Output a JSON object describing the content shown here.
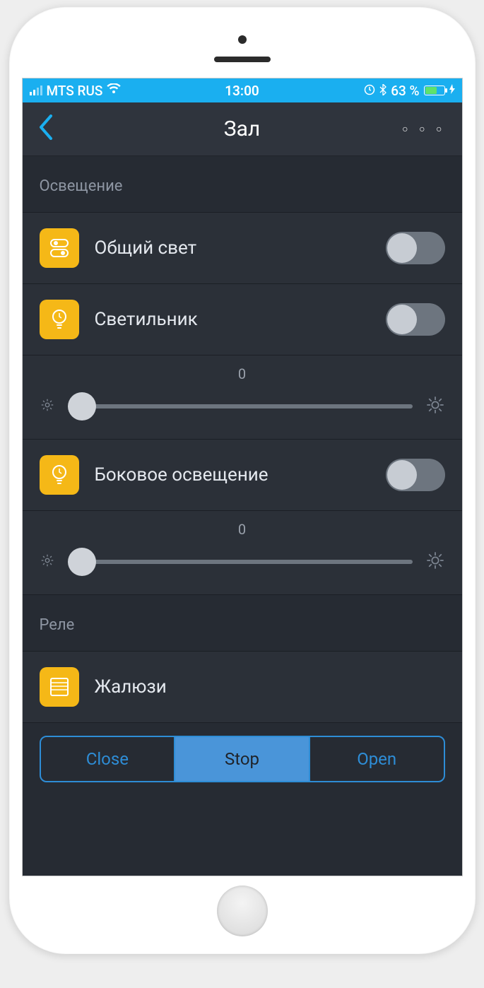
{
  "status": {
    "carrier": "MTS RUS",
    "time": "13:00",
    "battery_text": "63 %",
    "battery_pct": 63
  },
  "nav": {
    "title": "Зал"
  },
  "sections": {
    "lighting": {
      "header": "Освещение",
      "items": [
        {
          "label": "Общий свет",
          "toggle": false
        },
        {
          "label": "Светильник",
          "toggle": false,
          "slider_value": "0"
        },
        {
          "label": "Боковое освещение",
          "toggle": false,
          "slider_value": "0"
        }
      ]
    },
    "relay": {
      "header": "Реле",
      "items": [
        {
          "label": "Жалюзи"
        }
      ],
      "segmented": {
        "close": "Close",
        "stop": "Stop",
        "open": "Open",
        "active": "stop"
      }
    }
  }
}
